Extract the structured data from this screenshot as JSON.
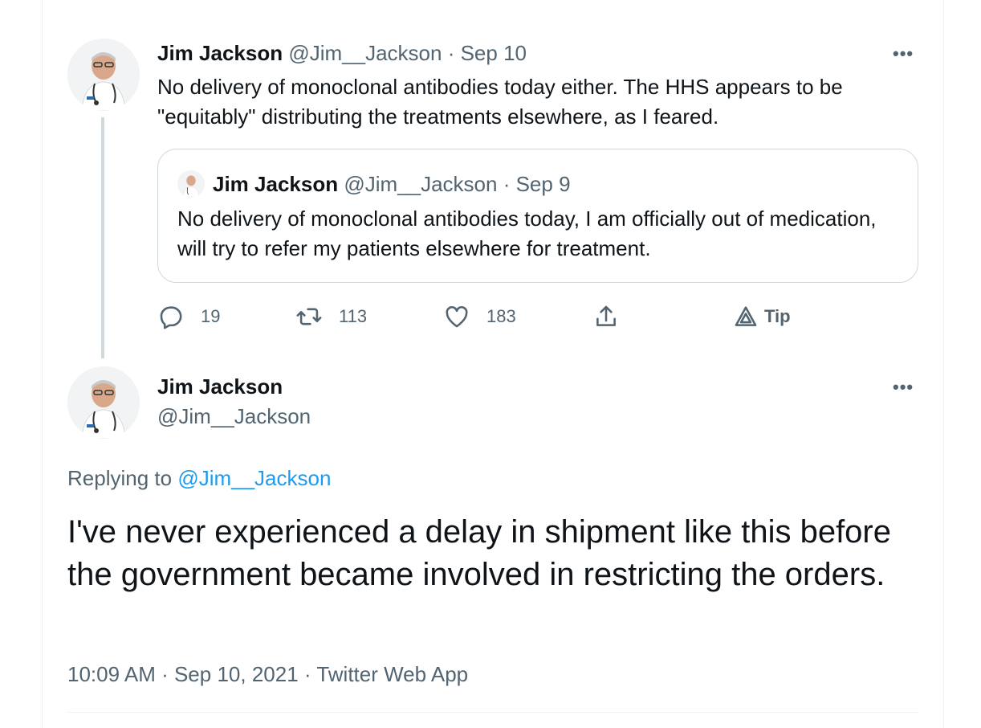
{
  "parent_tweet": {
    "author_name": "Jim Jackson",
    "author_handle": "@Jim__Jackson",
    "separator": " · ",
    "date": "Sep 10",
    "text": "No delivery of monoclonal antibodies today either. The HHS appears to be \"equitably\" distributing the treatments elsewhere, as I feared.",
    "more_label": "•••",
    "quoted_tweet": {
      "author_name": "Jim Jackson",
      "author_handle": "@Jim__Jackson",
      "separator": " · ",
      "date": "Sep 9",
      "text": "No delivery of monoclonal antibodies today, I am officially out of medication, will try to refer my patients elsewhere for treatment."
    },
    "actions": {
      "reply_count": "19",
      "retweet_count": "113",
      "like_count": "183",
      "tip_label": "Tip"
    }
  },
  "main_tweet": {
    "author_name": "Jim Jackson",
    "author_handle": "@Jim__Jackson",
    "more_label": "•••",
    "replying_prefix": "Replying to ",
    "replying_to": "@Jim__Jackson",
    "text": "I've never experienced a delay in shipment like this before the government became involved in restricting the orders.",
    "time": "10:09 AM",
    "separator": " · ",
    "date": "Sep 10, 2021",
    "source": "Twitter Web App"
  },
  "colors": {
    "text_primary": "#0f1419",
    "text_secondary": "#536471",
    "link": "#1d9bf0",
    "border": "#cfd9de"
  },
  "icons": {
    "reply": "reply-icon",
    "retweet": "retweet-icon",
    "like": "heart-icon",
    "share": "share-icon",
    "tip": "tip-icon",
    "more": "more-icon"
  }
}
